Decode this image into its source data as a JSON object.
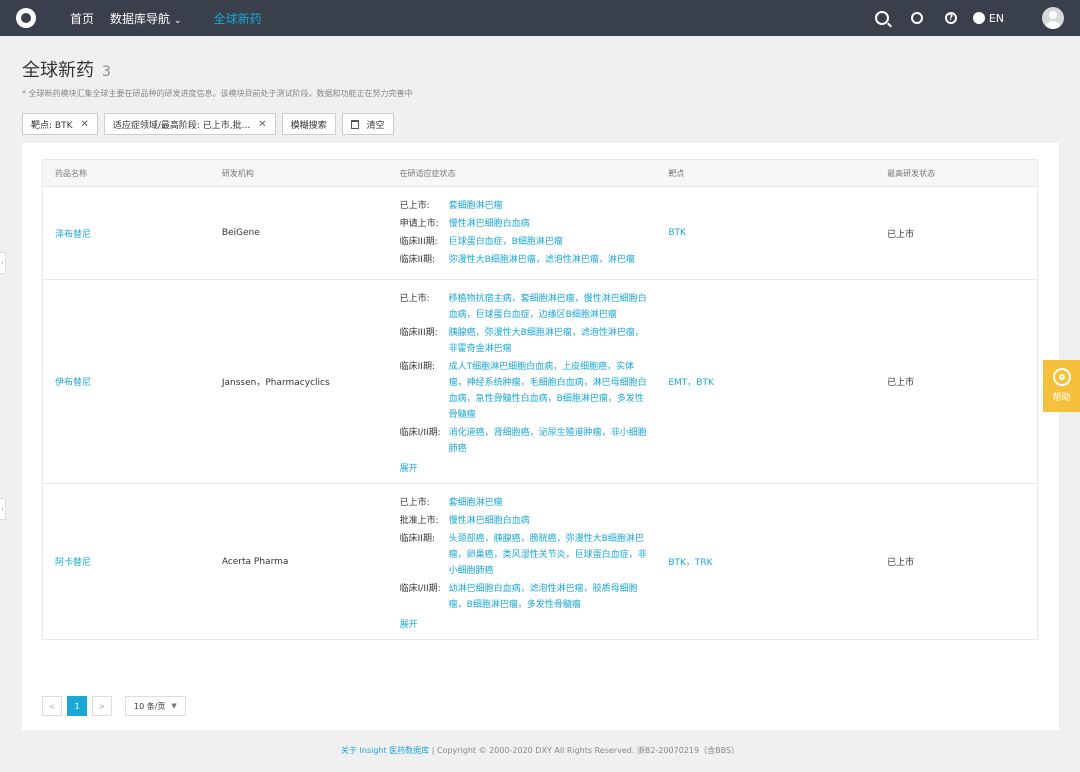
{
  "nav": {
    "items": [
      {
        "label": "首页"
      },
      {
        "label": "数据库导航"
      }
    ],
    "active": "全球新药",
    "lang": "EN"
  },
  "page": {
    "title": "全球新药",
    "count": "3",
    "desc": "* 全球新药模块汇集全球主要在研品种的研发进度信息。该模块目前处于测试阶段，数据和功能正在努力完善中"
  },
  "filters": {
    "target": "靶点: BTK",
    "indication": "适应症领域/最高阶段: 已上市,批...",
    "fuzzy": "模糊搜索",
    "clear": "清空"
  },
  "table": {
    "headers": [
      "药品名称",
      "研发机构",
      "在研适应症状态",
      "靶点",
      "最高研发状态"
    ],
    "rows": [
      {
        "name": "泽布替尼",
        "org": "BeiGene",
        "status": [
          {
            "label": "已上市:",
            "value": "套细胞淋巴瘤"
          },
          {
            "label": "申请上市:",
            "value": "慢性淋巴细胞白血病"
          },
          {
            "label": "临床III期:",
            "value": "巨球蛋白血症，B细胞淋巴瘤"
          },
          {
            "label": "临床II期:",
            "value": "弥漫性大B细胞淋巴瘤，滤泡性淋巴瘤，淋巴瘤"
          }
        ],
        "expand": "",
        "target": "BTK",
        "highest": "已上市"
      },
      {
        "name": "伊布替尼",
        "org": "Janssen，Pharmacyclics",
        "status": [
          {
            "label": "已上市:",
            "value": "移植物抗宿主病，套细胞淋巴瘤，慢性淋巴细胞白血病，巨球蛋白血症，边缘区B细胞淋巴瘤"
          },
          {
            "label": "临床III期:",
            "value": "胰腺癌，弥漫性大B细胞淋巴瘤，滤泡性淋巴瘤，非霍奇金淋巴瘤"
          },
          {
            "label": "临床II期:",
            "value": "成人T细胞淋巴细胞白血病，上皮细胞癌，实体瘤，神经系统肿瘤，毛细胞白血病，淋巴母细胞白血病，急性骨髓性白血病，B细胞淋巴瘤，多发性骨髓瘤"
          },
          {
            "label": "临床I/II期:",
            "value": "消化道癌，肾细胞癌，泌尿生殖道肿瘤，非小细胞肺癌"
          }
        ],
        "expand": "展开",
        "target": "EMT，BTK",
        "highest": "已上市"
      },
      {
        "name": "阿卡替尼",
        "org": "Acerta Pharma",
        "status": [
          {
            "label": "已上市:",
            "value": "套细胞淋巴瘤"
          },
          {
            "label": "批准上市:",
            "value": "慢性淋巴细胞白血病"
          },
          {
            "label": "临床II期:",
            "value": "头颈部癌，胰腺癌，膀胱癌，弥漫性大B细胞淋巴瘤，卵巢癌，类风湿性关节炎，巨球蛋白血症，非小细胞肺癌"
          },
          {
            "label": "临床I/II期:",
            "value": "幼淋巴细胞白血病，滤泡性淋巴瘤，胶质母细胞瘤，B细胞淋巴瘤，多发性骨髓瘤"
          }
        ],
        "expand": "展开",
        "target": "BTK，TRK",
        "highest": "已上市"
      }
    ]
  },
  "pager": {
    "prev": "<",
    "current": "1",
    "next": ">",
    "size": "10 条/页"
  },
  "footer": {
    "link": "关于 Insight 医药数据库",
    "text": "| Copyright © 2000-2020 DXY All Rights Reserved. 浙B2-20070219（含BBS）"
  },
  "help": "帮助"
}
